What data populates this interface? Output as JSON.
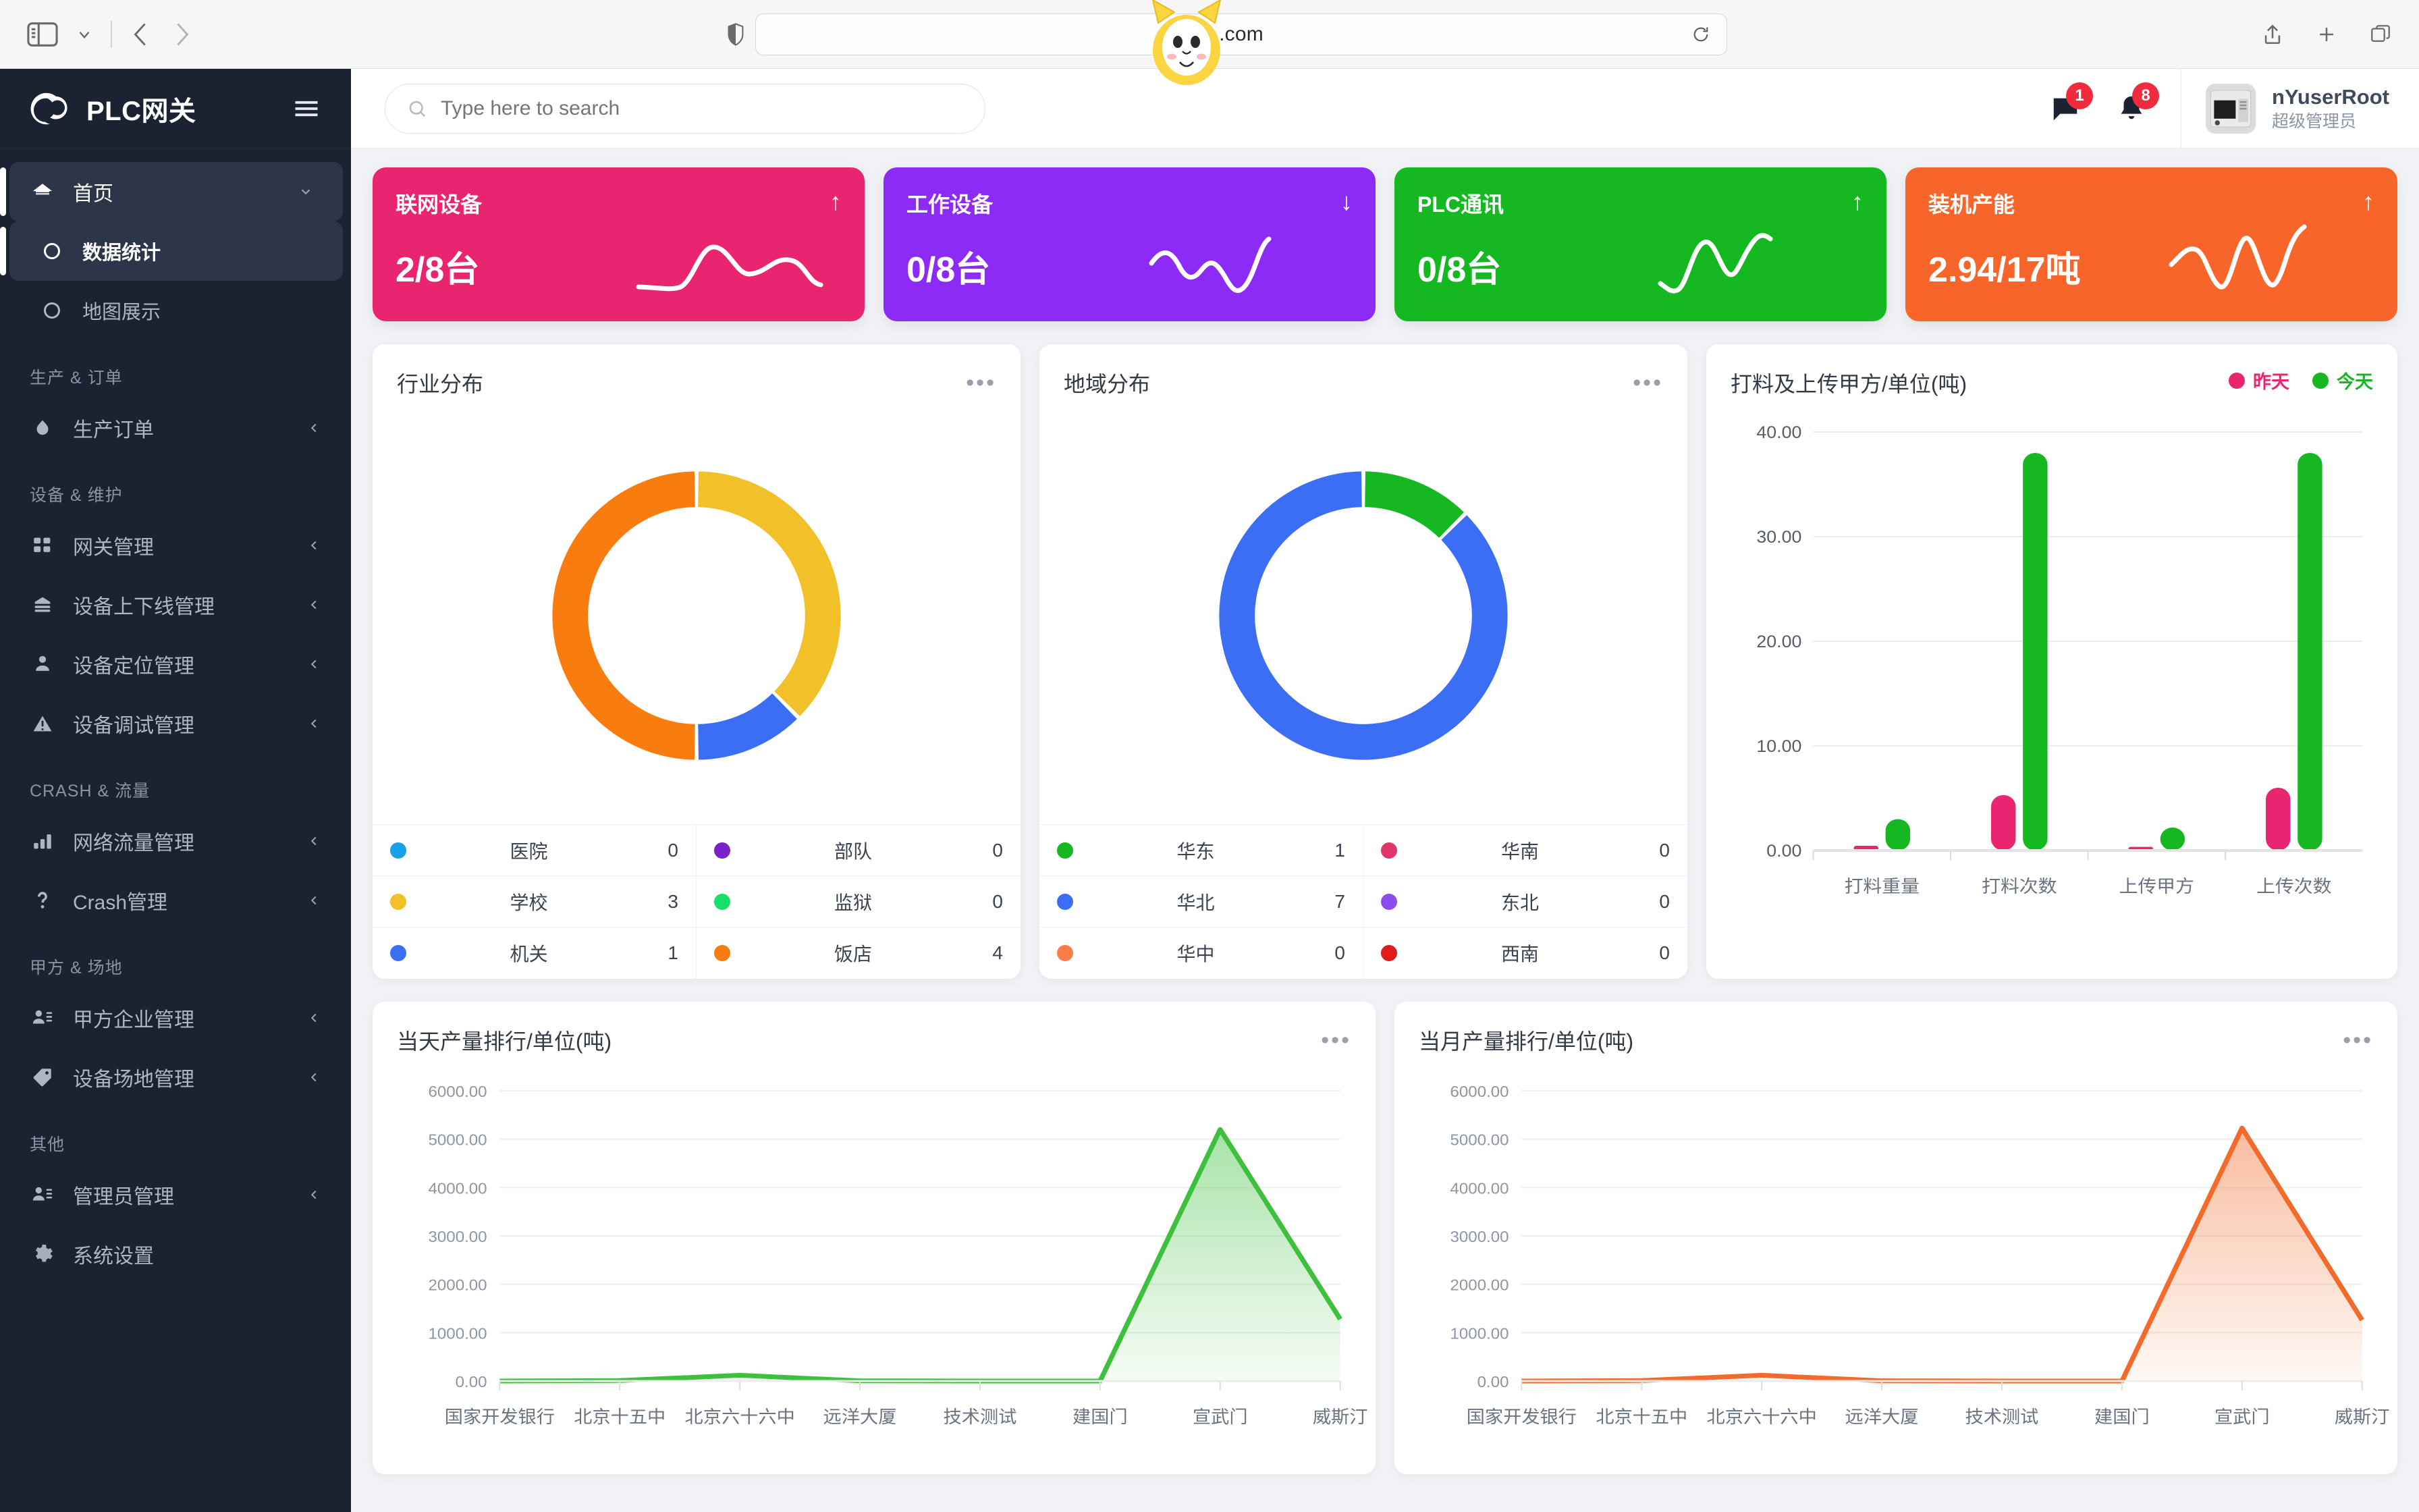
{
  "browser": {
    "url_text": ".com",
    "icons": [
      "sidebar-toggle-icon",
      "chevron-down-icon",
      "back-arrow-icon",
      "forward-arrow-icon",
      "shield-icon",
      "reload-icon",
      "share-icon",
      "new-tab-icon",
      "tabs-icon"
    ]
  },
  "sidebar": {
    "brand": "PLC网关",
    "items": [
      {
        "label": "首页",
        "icon": "home-icon",
        "type": "parent",
        "active": true,
        "arrow": "chevron-down"
      },
      {
        "label": "数据统计",
        "icon": "circle-icon",
        "type": "sub",
        "active": true
      },
      {
        "label": "地图展示",
        "icon": "circle-icon",
        "type": "sub",
        "active": false
      },
      {
        "label": "生产 & 订单",
        "type": "group"
      },
      {
        "label": "生产订单",
        "icon": "droplet-icon",
        "type": "item",
        "arrow": "chevron-left"
      },
      {
        "label": "设备 & 维护",
        "type": "group"
      },
      {
        "label": "网关管理",
        "icon": "grid-icon",
        "type": "item",
        "arrow": "chevron-left"
      },
      {
        "label": "设备上下线管理",
        "icon": "server-icon",
        "type": "item",
        "arrow": "chevron-left"
      },
      {
        "label": "设备定位管理",
        "icon": "location-user-icon",
        "type": "item",
        "arrow": "chevron-left"
      },
      {
        "label": "设备调试管理",
        "icon": "warning-icon",
        "type": "item",
        "arrow": "chevron-left"
      },
      {
        "label": "CRASH & 流量",
        "type": "group"
      },
      {
        "label": "网络流量管理",
        "icon": "bar-chart-icon",
        "type": "item",
        "arrow": "chevron-left"
      },
      {
        "label": "Crash管理",
        "icon": "question-icon",
        "type": "item",
        "arrow": "chevron-left"
      },
      {
        "label": "甲方 & 场地",
        "type": "group"
      },
      {
        "label": "甲方企业管理",
        "icon": "user-list-icon",
        "type": "item",
        "arrow": "chevron-left"
      },
      {
        "label": "设备场地管理",
        "icon": "tag-icon",
        "type": "item",
        "arrow": "chevron-left"
      },
      {
        "label": "其他",
        "type": "group"
      },
      {
        "label": "管理员管理",
        "icon": "user-list-icon",
        "type": "item",
        "arrow": "chevron-left"
      },
      {
        "label": "系统设置",
        "icon": "settings-icon",
        "type": "item"
      }
    ]
  },
  "topbar": {
    "search_placeholder": "Type here to search",
    "message_badge": "1",
    "bell_badge": "8",
    "user_name": "nYuserRoot",
    "user_role": "超级管理员"
  },
  "kpi_cards": [
    {
      "title": "联网设备",
      "value": "2/8台",
      "arrow": "↑",
      "color": "#e8256e"
    },
    {
      "title": "工作设备",
      "value": "0/8台",
      "arrow": "↓",
      "color": "#8b2bf5"
    },
    {
      "title": "PLC通讯",
      "value": "0/8台",
      "arrow": "↑",
      "color": "#16b822"
    },
    {
      "title": "装机产能",
      "value": "2.94/17吨",
      "arrow": "↑",
      "color": "#f8652a"
    }
  ],
  "chart_data": [
    {
      "type": "pie",
      "title": "行业分布",
      "legend_position": "bottom-table",
      "categories": [
        "医院",
        "学校",
        "机关",
        "部队",
        "监狱",
        "饭店"
      ],
      "values": [
        0,
        3,
        1,
        0,
        0,
        4
      ],
      "colors": [
        "#18a0e8",
        "#f2c029",
        "#3b6ef5",
        "#7a21c9",
        "#16e06a",
        "#f97c0e"
      ]
    },
    {
      "type": "pie",
      "title": "地域分布",
      "legend_position": "bottom-table",
      "categories": [
        "华东",
        "华北",
        "华中",
        "华南",
        "东北",
        "西南"
      ],
      "values": [
        1,
        7,
        0,
        0,
        0,
        0
      ],
      "colors": [
        "#16b822",
        "#3b6ef5",
        "#f97c4a",
        "#e2356b",
        "#8b4df0",
        "#e01d1d"
      ]
    },
    {
      "type": "bar",
      "title": "打料及上传甲方/单位(吨)",
      "categories": [
        "打料重量",
        "打料次数",
        "上传甲方",
        "上传次数"
      ],
      "series": [
        {
          "name": "昨天",
          "values": [
            0.45,
            5.3,
            0.35,
            6.0
          ],
          "color": "#e8256e"
        },
        {
          "name": "今天",
          "values": [
            3.0,
            38.0,
            2.2,
            38.0
          ],
          "color": "#16b822"
        }
      ],
      "ylim": [
        0,
        40
      ],
      "yticks": [
        "0.00",
        "10.00",
        "20.00",
        "30.00",
        "40.00"
      ],
      "grid": true,
      "legend_position": "top-right"
    },
    {
      "type": "area",
      "title": "当天产量排行/单位(吨)",
      "categories": [
        "国家开发银行",
        "北京十五中",
        "北京六十六中",
        "远洋大厦",
        "技术测试",
        "建国门",
        "宣武门",
        "威斯汀"
      ],
      "values": [
        0,
        10,
        120,
        5,
        0,
        0,
        5200,
        1280
      ],
      "ylim": [
        0,
        6000
      ],
      "yticks": [
        "0.00",
        "1000.00",
        "2000.00",
        "3000.00",
        "4000.00",
        "5000.00",
        "6000.00"
      ],
      "color": "#3ec03e",
      "grid": true
    },
    {
      "type": "area",
      "title": "当月产量排行/单位(吨)",
      "categories": [
        "国家开发银行",
        "北京十五中",
        "北京六十六中",
        "远洋大厦",
        "技术测试",
        "建国门",
        "宣武门",
        "威斯汀"
      ],
      "values": [
        0,
        10,
        120,
        5,
        0,
        0,
        5230,
        1260
      ],
      "ylim": [
        0,
        6000
      ],
      "yticks": [
        "0.00",
        "1000.00",
        "2000.00",
        "3000.00",
        "4000.00",
        "5000.00",
        "6000.00"
      ],
      "color": "#f26b2a",
      "grid": true
    }
  ]
}
